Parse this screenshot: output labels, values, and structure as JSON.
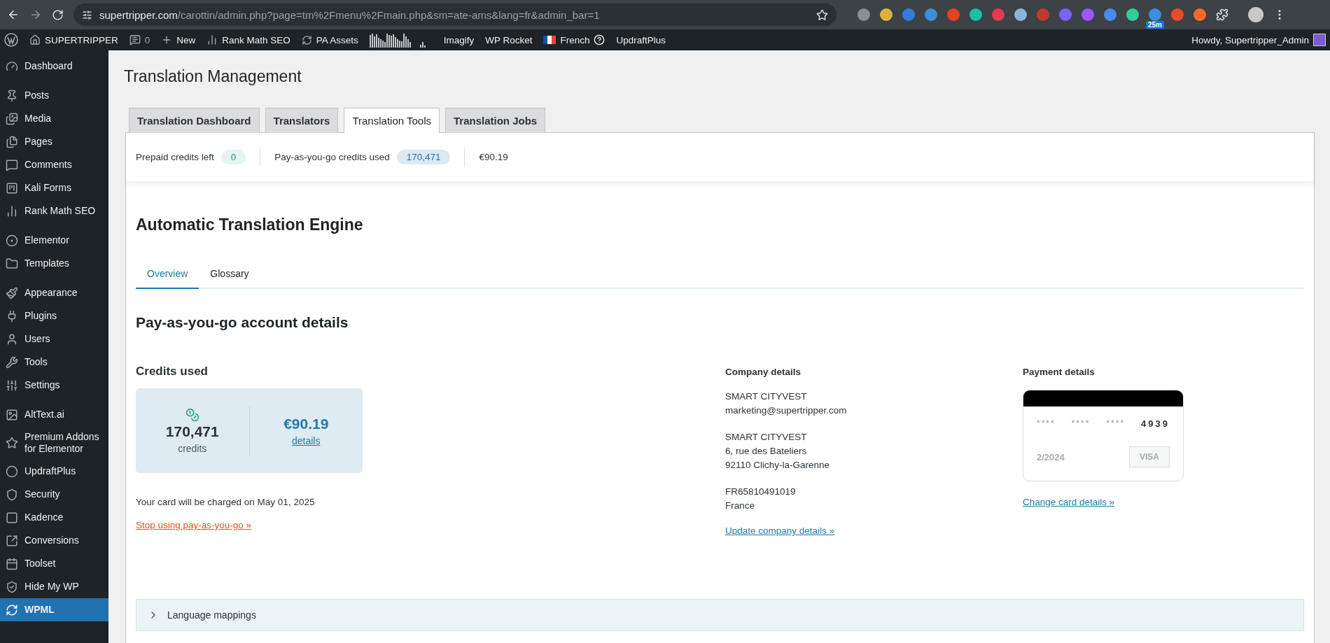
{
  "browser": {
    "url_host": "supertripper.com",
    "url_path": "/carottin/admin.php?page=tm%2Fmenu%2Fmain.php&sm=ate-ams&lang=fr&admin_bar=1",
    "extension_badge": "25m"
  },
  "admin_bar": {
    "items": [
      {
        "kind": "site",
        "label": "SUPERTRIPPER"
      },
      {
        "kind": "comments",
        "label": "0"
      },
      {
        "kind": "new",
        "label": "New"
      },
      {
        "kind": "seo",
        "label": "Rank Math SEO"
      },
      {
        "kind": "assets",
        "label": "PA Assets"
      },
      {
        "kind": "graph"
      },
      {
        "kind": "text",
        "label": "Imagify"
      },
      {
        "kind": "text",
        "label": "WP Rocket"
      },
      {
        "kind": "language",
        "label": "French"
      },
      {
        "kind": "text",
        "label": "UpdraftPlus"
      }
    ],
    "greeting": "Howdy, Supertripper_Admin"
  },
  "sidebar": {
    "groups": [
      [
        {
          "label": "Dashboard",
          "selected": false
        }
      ],
      [
        {
          "label": "Posts",
          "selected": false
        },
        {
          "label": "Media",
          "selected": false
        },
        {
          "label": "Pages",
          "selected": false
        },
        {
          "label": "Comments",
          "selected": false
        },
        {
          "label": "Kali Forms",
          "selected": false
        },
        {
          "label": "Rank Math SEO",
          "selected": false
        }
      ],
      [
        {
          "label": "Elementor",
          "selected": false
        },
        {
          "label": "Templates",
          "selected": false
        }
      ],
      [
        {
          "label": "Appearance",
          "selected": false
        },
        {
          "label": "Plugins",
          "selected": false
        },
        {
          "label": "Users",
          "selected": false
        },
        {
          "label": "Tools",
          "selected": false
        },
        {
          "label": "Settings",
          "selected": false
        }
      ],
      [
        {
          "label": "AltText.ai",
          "selected": false
        },
        {
          "label": "Premium Addons for Elementor",
          "selected": false
        },
        {
          "label": "UpdraftPlus",
          "selected": false
        },
        {
          "label": "Security",
          "selected": false
        },
        {
          "label": "Kadence",
          "selected": false
        },
        {
          "label": "Conversions",
          "selected": false
        },
        {
          "label": "Toolset",
          "selected": false
        },
        {
          "label": "Hide My WP",
          "selected": false
        },
        {
          "label": "WPML",
          "selected": true
        }
      ]
    ]
  },
  "page_title": "Translation Management",
  "tabs": [
    {
      "label": "Translation Dashboard",
      "selected": false
    },
    {
      "label": "Translators",
      "selected": false
    },
    {
      "label": "Translation Tools",
      "selected": true
    },
    {
      "label": "Translation Jobs",
      "selected": false
    }
  ],
  "credits_bar": {
    "prepaid_label": "Prepaid credits left",
    "prepaid_value": "0",
    "payg_label": "Pay-as-you-go credits used",
    "payg_value": "170,471",
    "cost": "€90.19"
  },
  "engine": {
    "title": "Automatic Translation Engine",
    "tabs": [
      {
        "label": "Overview",
        "selected": true
      },
      {
        "label": "Glossary",
        "selected": false
      }
    ],
    "section_title": "Pay-as-you-go account details",
    "credits": {
      "title": "Credits used",
      "count": "170,471",
      "unit": "credits",
      "amount": "€90.19",
      "details_link": "details",
      "charge_note": "Your card will be charged on May 01, 2025",
      "stop_link": "Stop using pay-as-you-go »"
    },
    "company": {
      "title": "Company details",
      "blocks": [
        [
          "SMART CITYVEST",
          "marketing@supertripper.com"
        ],
        [
          "SMART CITYVEST",
          "6, rue des Bateliers",
          "92110 Clichy-la-Garenne"
        ],
        [
          "FR65810491019",
          "France"
        ]
      ],
      "link": "Update company details »"
    },
    "payment": {
      "title": "Payment details",
      "masked": [
        "****",
        "****",
        "****"
      ],
      "last4": "4939",
      "expiry": "2/2024",
      "brand": "VISA",
      "link": "Change card details »"
    },
    "accordion": [
      {
        "label": "Language mappings",
        "expanded": false
      }
    ]
  }
}
